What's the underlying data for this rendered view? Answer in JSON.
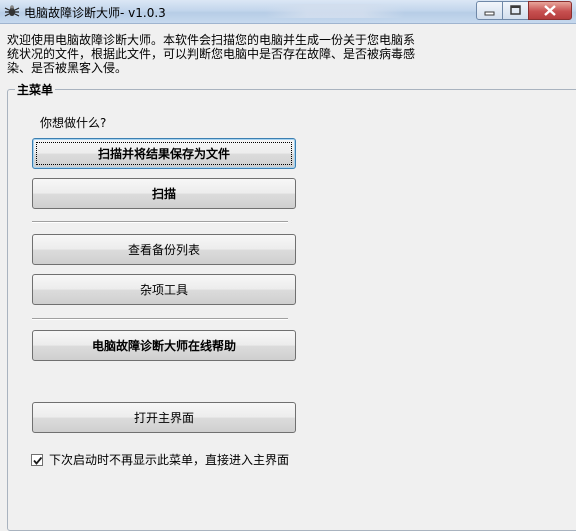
{
  "window": {
    "title": "电脑故障诊断大师- v1.0.3",
    "title_blurred_text": "\u0000",
    "app_icon": "bug-spider-icon",
    "controls": [
      "minimize-icon",
      "maximize-icon",
      "close-icon"
    ]
  },
  "intro_text": "欢迎使用电脑故障诊断大师。本软件会扫描您的电脑并生成一份关于您电脑系统状况的文件，根据此文件，可以判断您电脑中是否存在故障、是否被病毒感染、是否被黑客入侵。",
  "main_menu": {
    "group_label": "主菜单",
    "question": "你想做什么?",
    "buttons": {
      "scan_save": "扫描并将结果保存为文件",
      "scan": "扫描",
      "view_backup": "查看备份列表",
      "misc_tools": "杂项工具",
      "online_help": "电脑故障诊断大师在线帮助",
      "open_main": "打开主界面"
    },
    "skip_menu_checkbox": {
      "label": "下次启动时不再显示此菜单，直接进入主界面",
      "checked": true
    }
  }
}
